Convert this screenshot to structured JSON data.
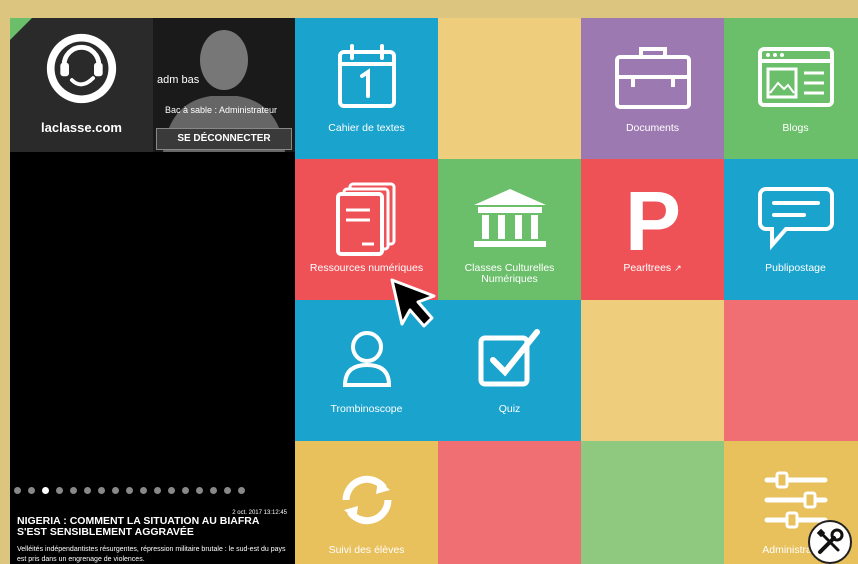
{
  "brand": {
    "name": "laclasse.com"
  },
  "user": {
    "name": "adm bas",
    "role": "Bac à sable : Administrateur",
    "logout_label": "SE DÉCONNECTER"
  },
  "carousel": {
    "dot_count": 17,
    "active_index": 2
  },
  "news": {
    "date": "2 oct. 2017 13:12:45",
    "title": "Nigeria : comment la situation au Biafra s'est sensiblement aggravée",
    "body": "Velléités indépendantistes résurgentes, répression militaire brutale : le sud-est du pays est pris dans un engrenage de violences."
  },
  "tiles": {
    "cahier": "Cahier de textes",
    "documents": "Documents",
    "blogs": "Blogs",
    "ressources": "Ressources numériques",
    "classes": "Classes Culturelles Numériques",
    "pearltrees": "Pearltrees",
    "publipostage": "Publipostage",
    "trombinoscope": "Trombinoscope",
    "quiz": "Quiz",
    "suivi": "Suivi des élèves",
    "administration": "Administration"
  },
  "colors": {
    "background": "#dcc57e",
    "blue": "#1aa3cc",
    "yellow": "#eecd7c",
    "purple": "#9d79b1",
    "green": "#6bbf6a",
    "red": "#ee5257",
    "pink": "#ef6f72",
    "gold": "#e8c05c"
  }
}
